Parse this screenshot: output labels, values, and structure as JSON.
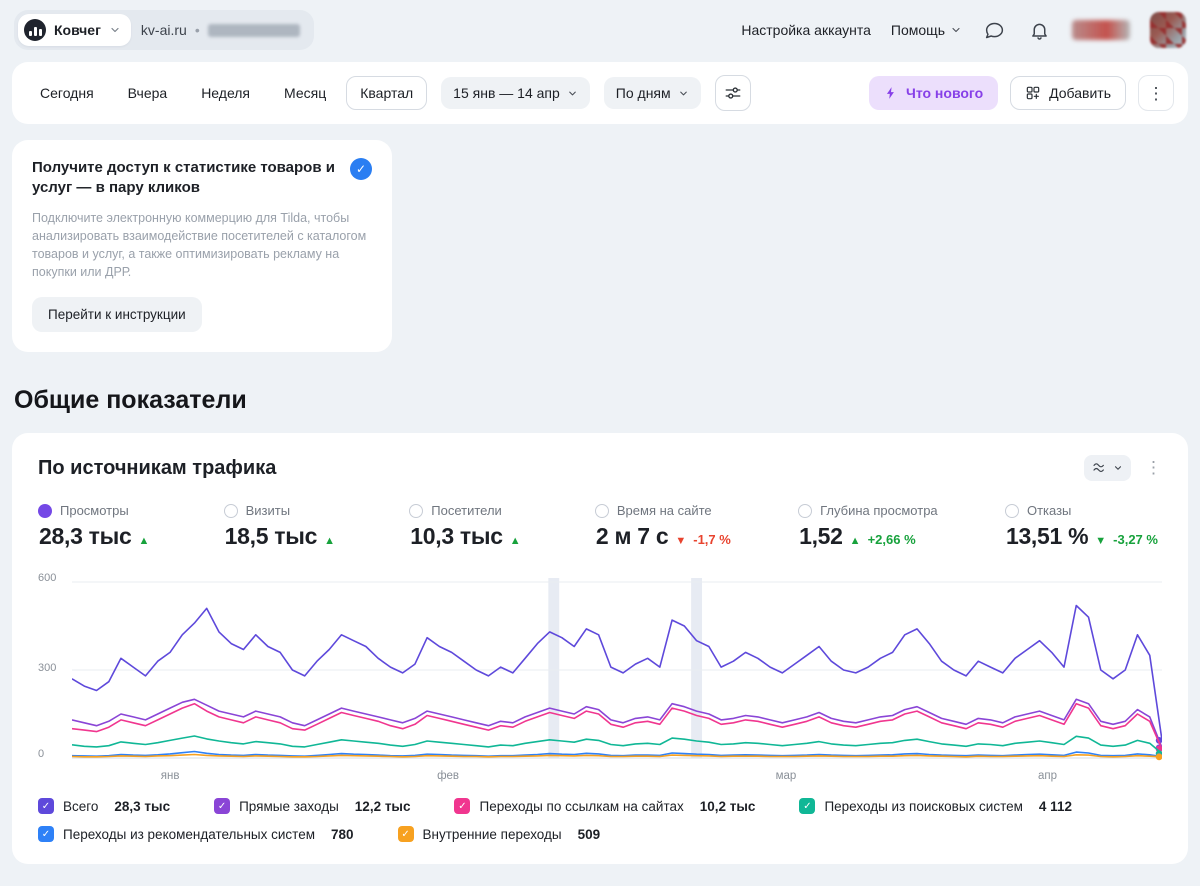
{
  "topbar": {
    "counter_name": "Ковчег",
    "site": "kv-ai.ru",
    "separator": "•",
    "account_settings": "Настройка аккаунта",
    "help": "Помощь"
  },
  "toolbar": {
    "periods": [
      "Сегодня",
      "Вчера",
      "Неделя",
      "Месяц",
      "Квартал"
    ],
    "active_period": "Квартал",
    "date_range": "15 янв — 14 апр",
    "group_by": "По дням",
    "whats_new": "Что нового",
    "add": "Добавить"
  },
  "promo": {
    "title": "Получите доступ к статистике товаров и услуг — в пару кликов",
    "description": "Подключите электронную коммерцию для Tilda, чтобы анализировать взаимодействие посетителей с каталогом товаров и услуг, а также оптимизировать рекламу на покупки или ДРР.",
    "button": "Перейти к инструкции"
  },
  "section_title": "Общие показатели",
  "chart_card": {
    "title": "По источникам трафика",
    "selected_dot_color": "#7448e6",
    "metrics": [
      {
        "label": "Просмотры",
        "value": "28,3 тыс",
        "direction": "up",
        "trend_color": "#17a23c",
        "delta": "",
        "selected": true
      },
      {
        "label": "Визиты",
        "value": "18,5 тыс",
        "direction": "up",
        "trend_color": "#17a23c",
        "delta": "",
        "selected": false
      },
      {
        "label": "Посетители",
        "value": "10,3 тыс",
        "direction": "up",
        "trend_color": "#17a23c",
        "delta": "",
        "selected": false
      },
      {
        "label": "Время на сайте",
        "value": "2 м 7 с",
        "direction": "down",
        "trend_color": "#e8432e",
        "delta": "-1,7 %",
        "selected": false
      },
      {
        "label": "Глубина просмотра",
        "value": "1,52",
        "direction": "up",
        "trend_color": "#17a23c",
        "delta": "+2,66 %",
        "selected": false
      },
      {
        "label": "Отказы",
        "value": "13,51 %",
        "direction": "down",
        "trend_color": "#17a23c",
        "delta": "-3,27 %",
        "selected": false
      }
    ]
  },
  "chart_data": {
    "type": "line",
    "title": "По источникам трафика",
    "date_range": "15 янв — 14 апр",
    "group_by": "По дням",
    "ylim": [
      0,
      600
    ],
    "yticks": [
      0,
      300,
      600
    ],
    "grid": true,
    "x_axis_labels": [
      "янв",
      "фев",
      "мар",
      "апр"
    ],
    "x_label_fracs": [
      0.09,
      0.345,
      0.655,
      0.895
    ],
    "highlight_bands": [
      {
        "x_frac": 0.437,
        "width_frac": 0.01
      },
      {
        "x_frac": 0.568,
        "width_frac": 0.01
      }
    ],
    "series": [
      {
        "name": "Всего",
        "total": "28,3 тыс",
        "color": "#5e49db",
        "values": [
          270,
          245,
          230,
          260,
          340,
          310,
          280,
          330,
          360,
          420,
          460,
          510,
          430,
          390,
          370,
          420,
          380,
          360,
          300,
          280,
          330,
          370,
          420,
          400,
          380,
          340,
          310,
          290,
          320,
          410,
          380,
          360,
          330,
          300,
          280,
          310,
          290,
          340,
          390,
          430,
          410,
          380,
          440,
          420,
          310,
          290,
          320,
          340,
          310,
          470,
          450,
          400,
          380,
          310,
          330,
          360,
          340,
          310,
          290,
          320,
          350,
          380,
          330,
          300,
          290,
          310,
          340,
          360,
          420,
          440,
          390,
          330,
          300,
          280,
          330,
          310,
          290,
          340,
          370,
          400,
          360,
          310,
          520,
          480,
          300,
          270,
          300,
          420,
          350,
          60
        ]
      },
      {
        "name": "Прямые заходы",
        "total": "12,2 тыс",
        "color": "#8a45d6",
        "values": [
          130,
          120,
          110,
          125,
          150,
          140,
          130,
          150,
          170,
          190,
          200,
          180,
          160,
          150,
          140,
          160,
          150,
          140,
          120,
          110,
          130,
          150,
          170,
          160,
          150,
          140,
          130,
          120,
          135,
          160,
          150,
          140,
          130,
          120,
          110,
          125,
          120,
          140,
          155,
          170,
          160,
          150,
          175,
          165,
          130,
          120,
          135,
          140,
          130,
          185,
          175,
          160,
          150,
          130,
          135,
          145,
          140,
          130,
          120,
          130,
          140,
          155,
          135,
          125,
          120,
          130,
          140,
          145,
          165,
          175,
          155,
          135,
          125,
          115,
          135,
          130,
          120,
          140,
          150,
          160,
          145,
          130,
          200,
          185,
          125,
          115,
          125,
          165,
          140,
          35
        ]
      },
      {
        "name": "Переходы по ссылкам на сайтах",
        "total": "10,2 тыс",
        "color": "#f0368f",
        "values": [
          100,
          95,
          90,
          105,
          130,
          120,
          110,
          130,
          150,
          170,
          185,
          160,
          140,
          130,
          120,
          140,
          130,
          120,
          100,
          95,
          115,
          135,
          155,
          145,
          135,
          125,
          110,
          100,
          115,
          145,
          135,
          125,
          115,
          105,
          95,
          110,
          105,
          125,
          140,
          155,
          145,
          135,
          160,
          150,
          115,
          105,
          120,
          125,
          115,
          170,
          160,
          145,
          135,
          115,
          120,
          130,
          125,
          115,
          105,
          115,
          125,
          140,
          120,
          110,
          105,
          115,
          125,
          130,
          150,
          160,
          140,
          120,
          110,
          100,
          120,
          115,
          105,
          125,
          135,
          145,
          130,
          115,
          185,
          170,
          110,
          100,
          110,
          150,
          125,
          30
        ]
      },
      {
        "name": "Переходы из поисковых систем",
        "total": "4 112",
        "color": "#10b796",
        "values": [
          45,
          40,
          38,
          42,
          55,
          50,
          46,
          52,
          60,
          68,
          75,
          65,
          58,
          52,
          48,
          56,
          52,
          48,
          40,
          38,
          46,
          54,
          62,
          58,
          54,
          50,
          44,
          40,
          46,
          58,
          54,
          50,
          46,
          42,
          38,
          44,
          42,
          50,
          56,
          62,
          58,
          54,
          64,
          60,
          46,
          42,
          48,
          50,
          46,
          68,
          64,
          58,
          54,
          46,
          48,
          52,
          50,
          46,
          42,
          46,
          50,
          56,
          48,
          44,
          42,
          46,
          50,
          52,
          60,
          64,
          56,
          48,
          44,
          40,
          48,
          46,
          42,
          50,
          54,
          58,
          52,
          46,
          74,
          68,
          44,
          40,
          44,
          60,
          50,
          15
        ]
      },
      {
        "name": "Переходы из рекомендательных систем",
        "total": "780",
        "color": "#2e81f7",
        "values": [
          8,
          7,
          6,
          8,
          12,
          10,
          9,
          11,
          14,
          18,
          22,
          16,
          12,
          10,
          9,
          12,
          10,
          9,
          7,
          6,
          9,
          12,
          15,
          13,
          12,
          10,
          8,
          7,
          9,
          13,
          12,
          10,
          9,
          8,
          6,
          8,
          8,
          10,
          12,
          15,
          13,
          12,
          16,
          14,
          9,
          8,
          10,
          10,
          9,
          17,
          15,
          13,
          12,
          9,
          10,
          11,
          10,
          9,
          8,
          9,
          10,
          12,
          10,
          9,
          8,
          9,
          10,
          11,
          14,
          15,
          12,
          10,
          9,
          8,
          10,
          9,
          8,
          10,
          12,
          13,
          11,
          9,
          20,
          17,
          9,
          8,
          9,
          14,
          11,
          5
        ]
      },
      {
        "name": "Внутренние переходы",
        "total": "509",
        "color": "#f7a120",
        "values": [
          5,
          4,
          4,
          5,
          7,
          6,
          5,
          7,
          8,
          10,
          12,
          9,
          7,
          6,
          5,
          7,
          6,
          5,
          4,
          4,
          5,
          7,
          9,
          8,
          7,
          6,
          5,
          4,
          5,
          8,
          7,
          6,
          5,
          5,
          4,
          5,
          5,
          6,
          7,
          9,
          8,
          7,
          9,
          8,
          5,
          5,
          6,
          6,
          5,
          10,
          9,
          8,
          7,
          5,
          6,
          6,
          6,
          5,
          5,
          5,
          6,
          7,
          6,
          5,
          5,
          5,
          6,
          6,
          8,
          9,
          7,
          6,
          5,
          4,
          6,
          5,
          5,
          6,
          7,
          8,
          6,
          5,
          11,
          10,
          5,
          4,
          5,
          8,
          6,
          4
        ]
      }
    ]
  },
  "legend": {
    "items": [
      {
        "label": "Всего",
        "value": "28,3 тыс",
        "color": "#5e49db"
      },
      {
        "label": "Прямые заходы",
        "value": "12,2 тыс",
        "color": "#8a45d6"
      },
      {
        "label": "Переходы по ссылкам на сайтах",
        "value": "10,2 тыс",
        "color": "#f0368f"
      },
      {
        "label": "Переходы из поисковых систем",
        "value": "4 112",
        "color": "#10b796"
      },
      {
        "label": "Переходы из рекомендательных систем",
        "value": "780",
        "color": "#2e81f7"
      },
      {
        "label": "Внутренние переходы",
        "value": "509",
        "color": "#f7a120"
      }
    ]
  }
}
